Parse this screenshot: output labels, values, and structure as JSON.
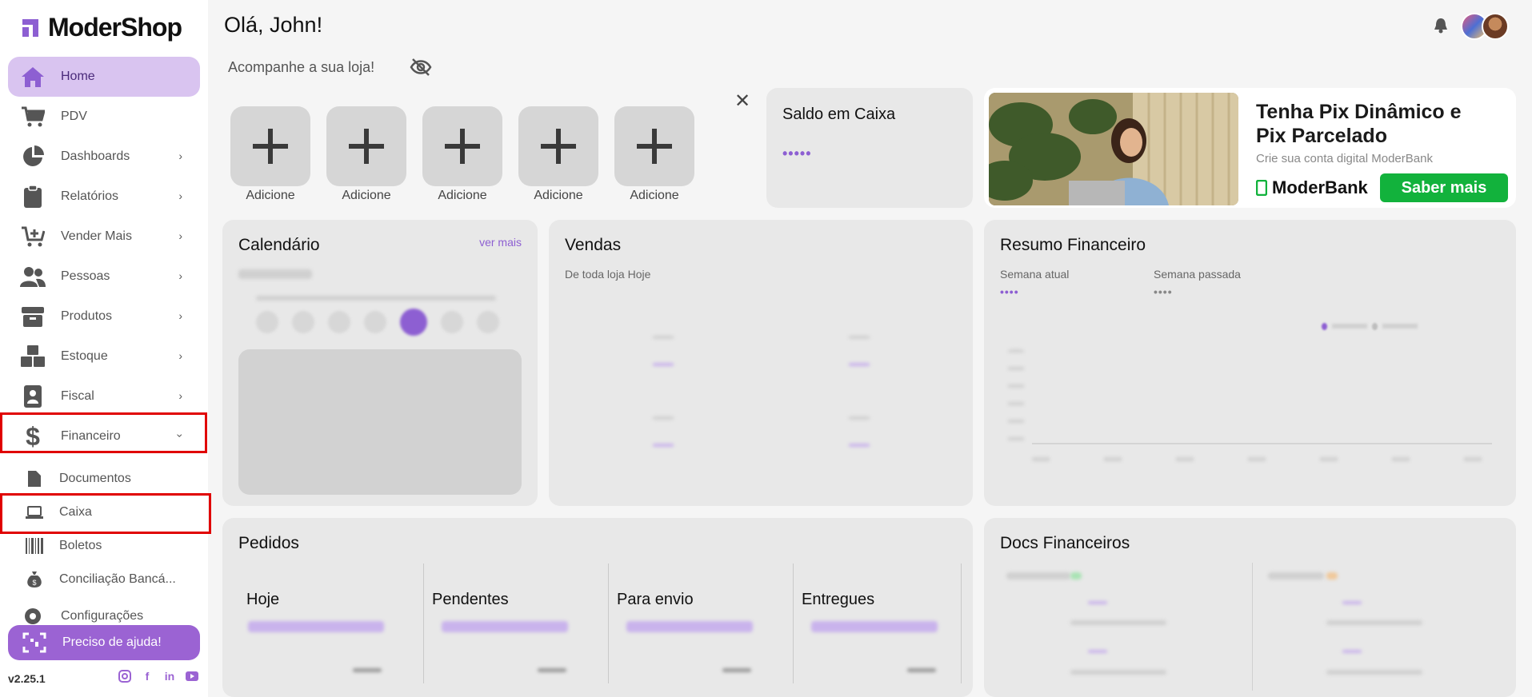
{
  "brand": {
    "name": "ModerShop",
    "accent": "#9b63d3"
  },
  "sidebar": {
    "items": [
      {
        "label": "Home",
        "icon": "home-icon",
        "active": true
      },
      {
        "label": "PDV",
        "icon": "cart-icon"
      },
      {
        "label": "Dashboards",
        "icon": "pie-chart-icon"
      },
      {
        "label": "Relatórios",
        "icon": "clipboard-icon"
      },
      {
        "label": "Vender Mais",
        "icon": "cart-plus-icon"
      },
      {
        "label": "Pessoas",
        "icon": "people-icon"
      },
      {
        "label": "Produtos",
        "icon": "box-icon"
      },
      {
        "label": "Estoque",
        "icon": "stock-icon"
      },
      {
        "label": "Fiscal",
        "icon": "id-badge-icon"
      },
      {
        "label": "Financeiro",
        "icon": "dollar-icon",
        "expanded": true
      }
    ],
    "sub_items": [
      {
        "label": "Documentos",
        "icon": "document-icon"
      },
      {
        "label": "Caixa",
        "icon": "laptop-icon"
      },
      {
        "label": "Boletos",
        "icon": "barcode-icon"
      },
      {
        "label": "Conciliação Bancá...",
        "icon": "money-bag-icon"
      }
    ],
    "config_label": "Configurações",
    "help_label": "Preciso de ajuda!",
    "version": "v2.25.1"
  },
  "header": {
    "greeting": "Olá, John!",
    "subtitle": "Acompanhe a sua loja!"
  },
  "quick_actions": [
    "Adicione",
    "Adicione",
    "Adicione",
    "Adicione",
    "Adicione"
  ],
  "saldo": {
    "title": "Saldo em Caixa",
    "value": "•••••"
  },
  "banner": {
    "title": "Tenha Pix Dinâmico e Pix Parcelado",
    "subtitle": "Crie sua conta digital ModerBank",
    "logo": "ModerBank",
    "button": "Saber mais"
  },
  "calendario": {
    "title": "Calendário",
    "link": "ver mais"
  },
  "vendas": {
    "title": "Vendas",
    "subtitle": "De toda loja Hoje"
  },
  "resumo": {
    "title": "Resumo Financeiro",
    "current_label": "Semana atual",
    "current_value": "••••",
    "previous_label": "Semana passada",
    "previous_value": "••••"
  },
  "pedidos": {
    "title": "Pedidos",
    "columns": [
      "Hoje",
      "Pendentes",
      "Para envio",
      "Entregues"
    ]
  },
  "docs": {
    "title": "Docs Financeiros"
  }
}
